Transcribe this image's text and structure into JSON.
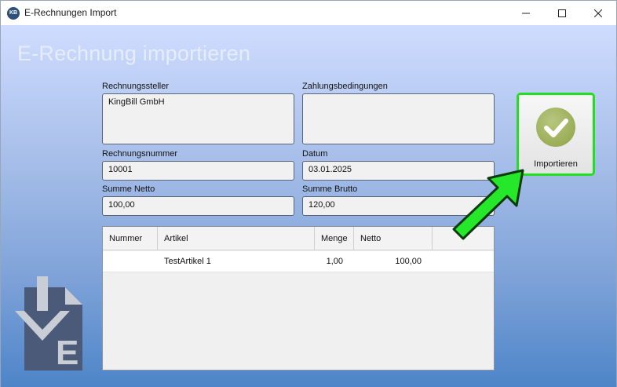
{
  "window": {
    "title": "E-Rechnungen Import",
    "icon_text": "KB",
    "controls": [
      "minimize-icon",
      "maximize-icon",
      "close-icon"
    ]
  },
  "heading": "E-Rechnung importieren",
  "fields": {
    "rechnungssteller": {
      "label": "Rechnungssteller",
      "value": "KingBill GmbH"
    },
    "zahlungsbedingungen": {
      "label": "Zahlungsbedingungen",
      "value": ""
    },
    "rechnungsnummer": {
      "label": "Rechnungsnummer",
      "value": "10001"
    },
    "datum": {
      "label": "Datum",
      "value": "03.01.2025"
    },
    "summe_netto": {
      "label": "Summe Netto",
      "value": "100,00"
    },
    "summe_brutto": {
      "label": "Summe Brutto",
      "value": "120,00"
    }
  },
  "table": {
    "columns": [
      "Nummer",
      "Artikel",
      "Menge",
      "Netto",
      ""
    ],
    "rows": [
      {
        "nummer": "",
        "artikel": "TestArtikel 1",
        "menge": "1,00",
        "netto": "100,00"
      }
    ]
  },
  "import_button": {
    "label": "Importieren",
    "icon": "checkmark-icon"
  },
  "colors": {
    "highlight": "#22e01f",
    "logo": "#4a5a78"
  }
}
